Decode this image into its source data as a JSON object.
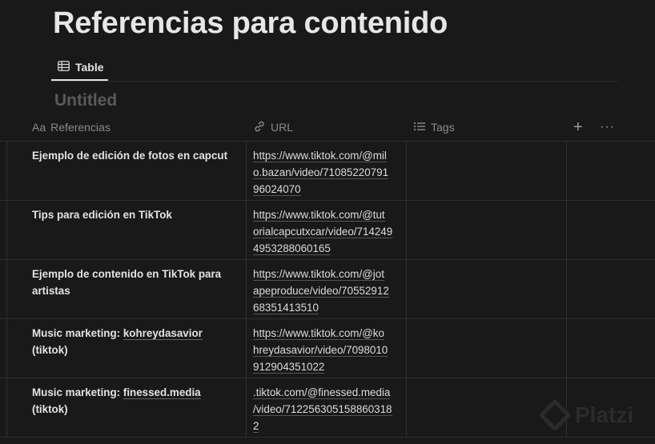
{
  "page": {
    "title": "Referencias para contenido"
  },
  "view_tab": {
    "label": "Table",
    "icon": "table-icon"
  },
  "database": {
    "title": "Untitled"
  },
  "columns": {
    "referencias": {
      "prefix": "Aa",
      "label": "Referencias"
    },
    "url": {
      "label": "URL",
      "icon": "link-icon"
    },
    "tags": {
      "label": "Tags",
      "icon": "list-icon"
    },
    "add": "+",
    "more": "···"
  },
  "rows": [
    {
      "ref_parts": [
        "Ejemplo de edición de fotos en capcut"
      ],
      "url_lines": [
        "https://www.tiktok.com/@mil",
        "o.bazan/video/71085220791",
        "96024070"
      ]
    },
    {
      "ref_parts": [
        "Tips para edición en TikTok"
      ],
      "url_lines": [
        "https://www.tiktok.com/@tut",
        "orialcapcutxcar/video/714249",
        "4953288060165"
      ]
    },
    {
      "ref_parts": [
        "Ejemplo de contenido en TikTok para artistas"
      ],
      "url_lines": [
        "https://www.tiktok.com/@jot",
        "apeproduce/video/70552912",
        "68351413510"
      ]
    },
    {
      "ref_parts": [
        "Music marketing: ",
        "kohreydasavior",
        " (tiktok)"
      ],
      "url_lines": [
        "https://www.tiktok.com/@ko",
        "hreydasavior/video/7098010",
        "912904351022"
      ]
    },
    {
      "ref_parts": [
        "Music marketing: ",
        "finessed.media",
        " (tiktok)"
      ],
      "url_lines": [
        ".tiktok.com/@finessed.media",
        "/video/712256305158860318",
        "2"
      ]
    }
  ],
  "watermark": {
    "text": "Platzi"
  }
}
